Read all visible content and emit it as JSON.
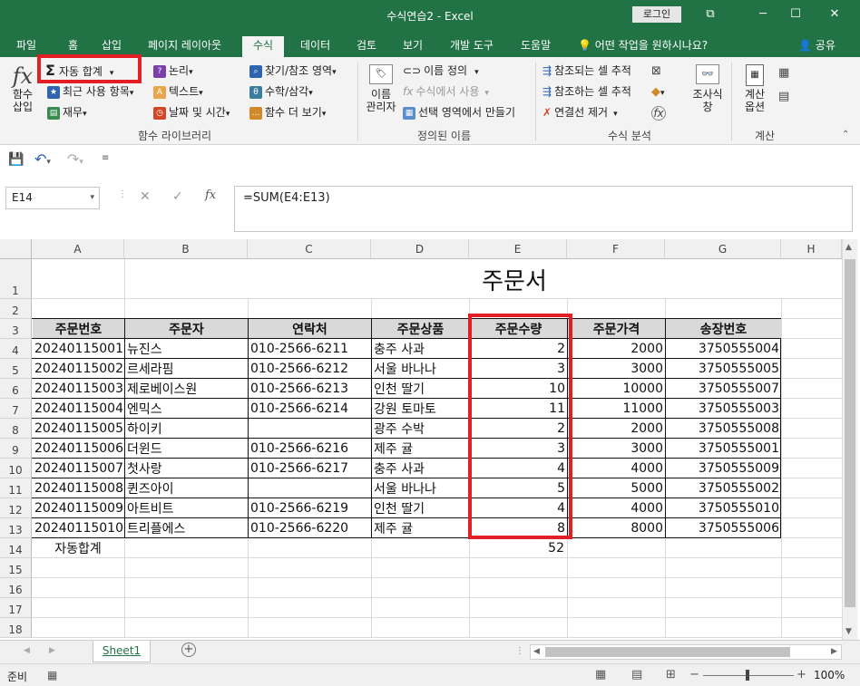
{
  "window": {
    "title": "수식연습2  -  Excel",
    "login_label": "로그인",
    "min_glyph": "─",
    "restore_glyph": "☐",
    "close_glyph": "✕",
    "ribbon_opt_glyph": "⧉"
  },
  "tabs": [
    "파일",
    "홈",
    "삽입",
    "페이지 레이아웃",
    "수식",
    "데이터",
    "검토",
    "보기",
    "개발 도구",
    "도움말"
  ],
  "active_tab": "수식",
  "tell_me": "어떤 작업을 원하시나요?",
  "share": "공유",
  "ribbon": {
    "insert_function": [
      "함수",
      "삽입"
    ],
    "autosum": "자동 합계",
    "recent": "최근 사용 항목",
    "finance": "재무",
    "logical": "논리",
    "text": "텍스트",
    "datetime": "날짜 및 시간",
    "lookup": "찾기/참조 영역",
    "math": "수학/삼각",
    "more_funcs": "함수 더 보기",
    "name_manager": [
      "이름",
      "관리자"
    ],
    "define_name": "이름 정의",
    "use_in_formula": "수식에서 사용",
    "create_from_selection": "선택 영역에서 만들기",
    "trace_precedents": "참조되는 셀 추적",
    "trace_dependents": "참조하는 셀 추적",
    "remove_arrows": "연결선 제거",
    "watch_window": [
      "조사식",
      "창"
    ],
    "calc_options": [
      "계산",
      "옵션"
    ],
    "groups": {
      "function_library": "함수 라이브러리",
      "defined_names": "정의된 이름",
      "formula_auditing": "수식 분석",
      "calculation": "계산"
    }
  },
  "formula_bar": {
    "name_box": "E14",
    "formula": "=SUM(E4:E13)",
    "fx": "fx"
  },
  "sheet": {
    "columns": [
      "A",
      "B",
      "C",
      "D",
      "E",
      "F",
      "G",
      "H"
    ],
    "rows": [
      "1",
      "2",
      "3",
      "4",
      "5",
      "6",
      "7",
      "8",
      "9",
      "10",
      "11",
      "12",
      "13",
      "14",
      "15",
      "16",
      "17",
      "18"
    ],
    "title": "주문서",
    "headers": [
      "주문번호",
      "주문자",
      "연락처",
      "주문상품",
      "주문수량",
      "주문가격",
      "송장번호"
    ],
    "data": [
      [
        "20240115001",
        "뉴진스",
        "010-2566-6211",
        "충주 사과",
        "2",
        "2000",
        "3750555004"
      ],
      [
        "20240115002",
        "르세라핌",
        "010-2566-6212",
        "서울 바나나",
        "3",
        "3000",
        "3750555005"
      ],
      [
        "20240115003",
        "제로베이스원",
        "010-2566-6213",
        "인천 딸기",
        "10",
        "10000",
        "3750555007"
      ],
      [
        "20240115004",
        "엔믹스",
        "010-2566-6214",
        "강원 토마토",
        "11",
        "11000",
        "3750555003"
      ],
      [
        "20240115005",
        "하이키",
        "",
        "광주 수박",
        "2",
        "2000",
        "3750555008"
      ],
      [
        "20240115006",
        "더윈드",
        "010-2566-6216",
        "제주 귤",
        "3",
        "3000",
        "3750555001"
      ],
      [
        "20240115007",
        "첫사랑",
        "010-2566-6217",
        "충주 사과",
        "4",
        "4000",
        "3750555009"
      ],
      [
        "20240115008",
        "퀸즈아이",
        "",
        "서울 바나나",
        "5",
        "5000",
        "3750555002"
      ],
      [
        "20240115009",
        "아트비트",
        "010-2566-6219",
        "인천 딸기",
        "4",
        "4000",
        "3750555010"
      ],
      [
        "20240115010",
        "트리플에스",
        "010-2566-6220",
        "제주 귤",
        "8",
        "8000",
        "3750555006"
      ]
    ],
    "total_label": "자동합계",
    "total_value": "52"
  },
  "sheet_tab": "Sheet1",
  "status": {
    "ready": "준비",
    "zoom": "100%",
    "zoom_minus": "−",
    "zoom_plus": "+"
  },
  "colors": {
    "excel_green": "#217346",
    "highlight_red": "#e31e24"
  }
}
